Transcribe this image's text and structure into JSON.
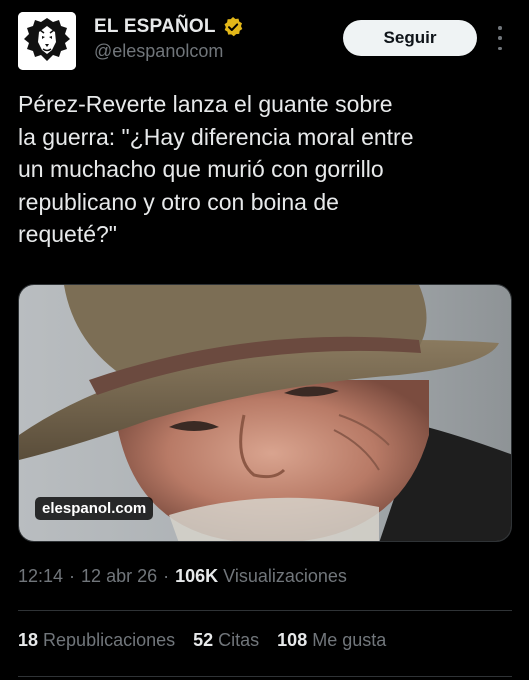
{
  "account": {
    "display_name": "EL ESPAÑOL",
    "handle": "@elespanolcom",
    "verified_color": "#e2b719",
    "follow_label": "Seguir"
  },
  "tweet": {
    "text": "Pérez-Reverte lanza el guante sobre\nla guerra: \"¿Hay diferencia moral entre\nun muchacho que murió con gorrillo\nrepublicano y otro con boina de\nrequeté?\"",
    "link_card": {
      "domain": "elespanol.com"
    }
  },
  "meta": {
    "time": "12:14",
    "date": "12 abr 26",
    "views_count": "106K",
    "views_label": "Visualizaciones"
  },
  "stats": {
    "reposts_count": "18",
    "reposts_label": "Republicaciones",
    "quotes_count": "52",
    "quotes_label": "Citas",
    "likes_count": "108",
    "likes_label": "Me gusta"
  },
  "colors": {
    "background": "#000000",
    "text_primary": "#e7e9ea",
    "text_secondary": "#71767b",
    "divider": "#2f3336"
  }
}
